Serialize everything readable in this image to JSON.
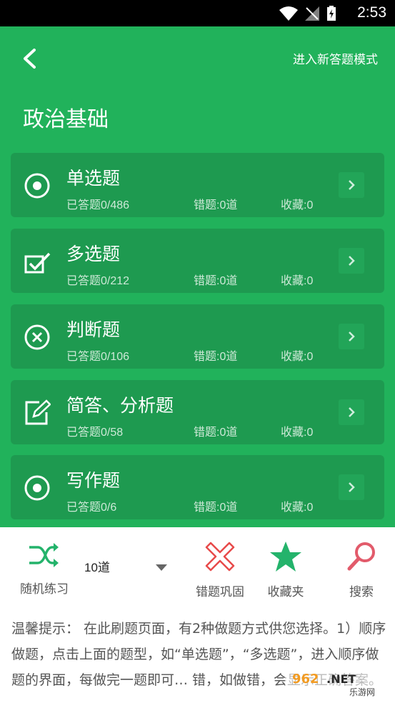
{
  "status_bar": {
    "time": "2:53"
  },
  "header": {
    "mode_link": "进入新答题模式",
    "title": "政治基础"
  },
  "cards": [
    {
      "icon": "radio-target-icon",
      "title": "单选题",
      "answered": "已答题0/486",
      "wrong": "错题:0道",
      "fav": "收藏:0"
    },
    {
      "icon": "checkbox-check-icon",
      "title": "多选题",
      "answered": "已答题0/212",
      "wrong": "错题:0道",
      "fav": "收藏:0"
    },
    {
      "icon": "circle-x-icon",
      "title": "判断题",
      "answered": "已答题0/106",
      "wrong": "错题:0道",
      "fav": "收藏:0"
    },
    {
      "icon": "edit-pencil-icon",
      "title": "简答、分析题",
      "answered": "已答题0/58",
      "wrong": "错题:0道",
      "fav": "收藏:0"
    },
    {
      "icon": "radio-target-icon",
      "title": "写作题",
      "answered": "已答题0/6",
      "wrong": "错题:0道",
      "fav": "收藏:0"
    }
  ],
  "toolbar": {
    "random": "随机练习",
    "count_value": "10道",
    "wrong": "错题巩固",
    "favorites": "收藏夹",
    "search": "搜索"
  },
  "tip": {
    "text": "温馨提示： 在此刷题页面，有2种做题方式供您选择。1）顺序做题，点击上面的题型，如“单选题”，“多选题”，进入顺序做题的界面，每做完一题即可… 错，如做错，会显示正确答案。"
  },
  "watermark": {
    "text": "962.NET 乐游网"
  },
  "colors": {
    "green": "#21b25b",
    "card": "#1e9a50",
    "red": "#e84a4a",
    "teal": "#24b36b",
    "pink": "#e25b6b"
  }
}
